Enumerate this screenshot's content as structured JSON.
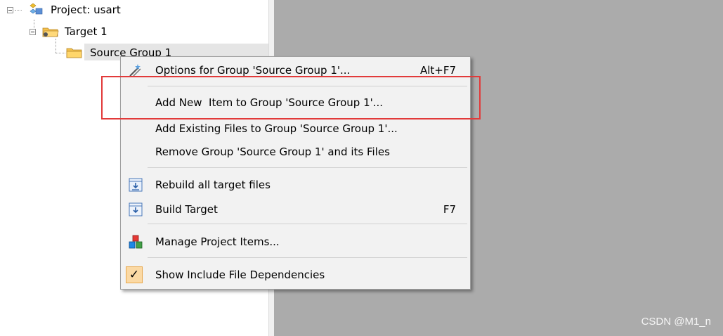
{
  "tree": {
    "project_label": "Project: usart",
    "target_label": "Target 1",
    "group_label": "Source Group 1"
  },
  "menu": {
    "items": [
      {
        "label": "Options for Group 'Source Group 1'...",
        "shortcut": "Alt+F7",
        "icon": "options-wand-icon"
      },
      {
        "label": "Add New  Item to Group 'Source Group 1'...",
        "shortcut": "",
        "icon": ""
      },
      {
        "label": "Add Existing Files to Group 'Source Group 1'...",
        "shortcut": "",
        "icon": ""
      },
      {
        "label": "Remove Group 'Source Group 1' and its Files",
        "shortcut": "",
        "icon": ""
      },
      {
        "label": "Rebuild all target files",
        "shortcut": "",
        "icon": "rebuild-icon"
      },
      {
        "label": "Build Target",
        "shortcut": "F7",
        "icon": "build-icon"
      },
      {
        "label": "Manage Project Items...",
        "shortcut": "",
        "icon": "manage-items-icon"
      },
      {
        "label": "Show Include File Dependencies",
        "shortcut": "",
        "icon": "checkmark-icon",
        "checked": true
      }
    ]
  },
  "annotation": {
    "highlight_color": "#e23a3a"
  },
  "watermark": "CSDN @M1_n",
  "colors": {
    "editor_bg": "#ababab",
    "menu_bg": "#f2f2f2",
    "check_bg": "#fbd9a4"
  }
}
